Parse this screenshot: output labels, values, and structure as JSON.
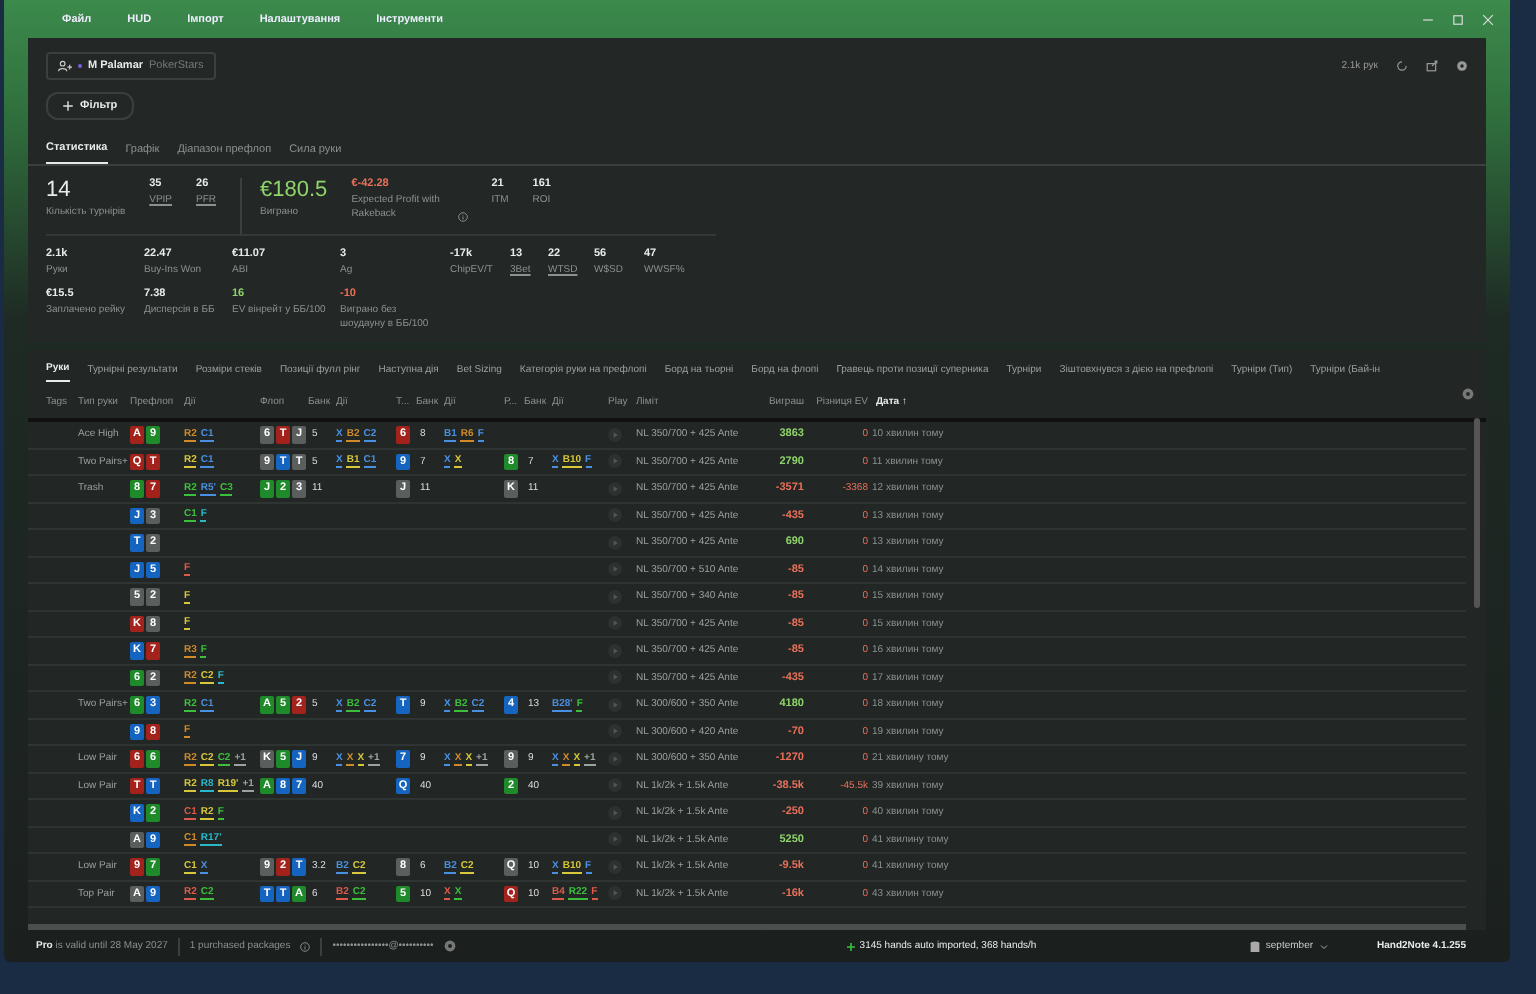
{
  "menu": [
    "Файл",
    "HUD",
    "Імпорт",
    "Налаштування",
    "Інструменти"
  ],
  "player": {
    "name": "M Palamar",
    "site": "PokerStars"
  },
  "hands_count": "2.1k рук",
  "filter_button": "Фільтр",
  "tabs": [
    {
      "label": "Статистика",
      "selected": true
    },
    {
      "label": "Графік",
      "selected": false
    },
    {
      "label": "Діапазон префлоп",
      "selected": false
    },
    {
      "label": "Сила руки",
      "selected": false
    }
  ],
  "summary": [
    {
      "value": "14",
      "label": "Кількість турнірів",
      "kind": "large"
    },
    {
      "value": "35",
      "label": "VPIP",
      "kind": "small",
      "underlined": true
    },
    {
      "value": "26",
      "label": "PFR",
      "kind": "small",
      "underlined": true
    },
    {
      "value": "€180.5",
      "label": "Виграно",
      "kind": "large",
      "color": "#8fd46a",
      "divider_before": true
    },
    {
      "value": "€-42.28",
      "label": "Expected Profit with Rakeback",
      "kind": "small",
      "color": "#e8705a",
      "info": true
    },
    {
      "value": "21",
      "label": "ITM",
      "kind": "small"
    },
    {
      "value": "161",
      "label": "ROI",
      "kind": "small"
    }
  ],
  "stats": [
    {
      "value": "2.1k",
      "label": "Руки"
    },
    {
      "value": "22.47",
      "label": "Buy-Ins Won"
    },
    {
      "value": "€11.07",
      "label": "ABI"
    },
    {
      "value": "3",
      "label": "Ag"
    },
    {
      "value": "-17k",
      "label": "ChipEV/T"
    },
    {
      "value": "13",
      "label": "3Bet",
      "underlined": true
    },
    {
      "value": "22",
      "label": "WTSD",
      "underlined": true
    },
    {
      "value": "56",
      "label": "W$SD"
    },
    {
      "value": "47",
      "label": "WWSF%"
    },
    {
      "value": "€15.5",
      "label": "Заплачено рейку"
    },
    {
      "value": "7.38",
      "label": "Дисперсія в ББ"
    },
    {
      "value": "16",
      "label": "EV вінрейт у ББ/100",
      "color": "#8fd46a"
    },
    {
      "value": "-10",
      "label": "Виграно без шоудауну в ББ/100",
      "color": "#e8705a"
    }
  ],
  "table_tabs": [
    {
      "label": "Руки",
      "selected": true
    },
    {
      "label": "Турнірні результати",
      "selected": false
    },
    {
      "label": "Розміри стеків",
      "selected": false
    },
    {
      "label": "Позиції фулл рінг",
      "selected": false
    },
    {
      "label": "Наступна дія",
      "selected": false
    },
    {
      "label": "Bet Sizing",
      "selected": false
    },
    {
      "label": "Категорія руки на префлопі",
      "selected": false
    },
    {
      "label": "Борд на тьорні",
      "selected": false
    },
    {
      "label": "Борд на флопі",
      "selected": false
    },
    {
      "label": "Гравець проти позиції суперника",
      "selected": false
    },
    {
      "label": "Турніри",
      "selected": false
    },
    {
      "label": "Зіштовхнувся з дією на префлопі",
      "selected": false
    },
    {
      "label": "Турніри (Тип)",
      "selected": false
    },
    {
      "label": "Турніри (Бай-ін",
      "selected": false
    }
  ],
  "columns": [
    {
      "label": "Tags",
      "sorted": false
    },
    {
      "label": "Тип руки",
      "sorted": false
    },
    {
      "label": "Префлоп",
      "sorted": false
    },
    {
      "label": "Дії",
      "sorted": false
    },
    {
      "label": "Флоп",
      "sorted": false
    },
    {
      "label": "Банк",
      "sorted": false
    },
    {
      "label": "Дії",
      "sorted": false
    },
    {
      "label": "Т...",
      "sorted": false
    },
    {
      "label": "Банк",
      "sorted": false
    },
    {
      "label": "Дії",
      "sorted": false
    },
    {
      "label": "Р...",
      "sorted": false
    },
    {
      "label": "Банк",
      "sorted": false
    },
    {
      "label": "Дії",
      "sorted": false
    },
    {
      "label": "Play",
      "sorted": false
    },
    {
      "label": "Ліміт",
      "sorted": false
    },
    {
      "label": "Виграш",
      "sorted": false
    },
    {
      "label": "Різниця EV",
      "sorted": false
    },
    {
      "label": "Дата",
      "sort_arrow": "↑",
      "sorted": true
    }
  ],
  "rows": [
    {
      "type": "Ace High",
      "pre": [
        {
          "rank": "A",
          "color": "#a3231c"
        },
        {
          "rank": "9",
          "color": "#1f8a2a"
        }
      ],
      "pre_act": [
        {
          "text": "R2",
          "color": "#d08a2a"
        },
        {
          "text": "C1",
          "color": "#4a90e2"
        }
      ],
      "flop": [
        {
          "rank": "6",
          "color": "#5a5f5d"
        },
        {
          "rank": "T",
          "color": "#a3231c"
        },
        {
          "rank": "J",
          "color": "#5a5f5d"
        }
      ],
      "flop_pot": "5",
      "flop_act": [
        {
          "text": "X",
          "color": "#4a90e2"
        },
        {
          "text": "B2",
          "color": "#d08a2a"
        },
        {
          "text": "C2",
          "color": "#4a90e2"
        }
      ],
      "turn": [
        {
          "rank": "6",
          "color": "#a3231c"
        }
      ],
      "turn_pot": "8",
      "turn_act": [
        {
          "text": "B1",
          "color": "#4a90e2"
        },
        {
          "text": "R6",
          "color": "#d08a2a"
        },
        {
          "text": "F",
          "color": "#4a90e2"
        }
      ],
      "limit": "NL 350/700 + 425 Ante",
      "win": {
        "text": "3863",
        "color": "#8fd46a"
      },
      "ev": "0",
      "date": "10 хвилин тому"
    },
    {
      "type": "Two Pairs+",
      "pre": [
        {
          "rank": "Q",
          "color": "#a3231c"
        },
        {
          "rank": "T",
          "color": "#a3231c"
        }
      ],
      "pre_act": [
        {
          "text": "R2",
          "color": "#d6c83a"
        },
        {
          "text": "C1",
          "color": "#4a90e2"
        }
      ],
      "flop": [
        {
          "rank": "9",
          "color": "#5a5f5d"
        },
        {
          "rank": "T",
          "color": "#1565c0"
        },
        {
          "rank": "T",
          "color": "#5a5f5d"
        }
      ],
      "flop_pot": "5",
      "flop_act": [
        {
          "text": "X",
          "color": "#4a90e2"
        },
        {
          "text": "B1",
          "color": "#d6c83a"
        },
        {
          "text": "C1",
          "color": "#4a90e2"
        }
      ],
      "turn": [
        {
          "rank": "9",
          "color": "#1565c0"
        }
      ],
      "turn_pot": "7",
      "turn_act": [
        {
          "text": "X",
          "color": "#4a90e2"
        },
        {
          "text": "X",
          "color": "#d6c83a"
        }
      ],
      "river": [
        {
          "rank": "8",
          "color": "#1f8a2a"
        }
      ],
      "river_pot": "7",
      "river_act": [
        {
          "text": "X",
          "color": "#4a90e2"
        },
        {
          "text": "B10",
          "color": "#d6c83a"
        },
        {
          "text": "F",
          "color": "#4a90e2"
        }
      ],
      "limit": "NL 350/700 + 425 Ante",
      "win": {
        "text": "2790",
        "color": "#8fd46a"
      },
      "ev": "0",
      "date": "11 хвилин тому"
    },
    {
      "type": "Trash",
      "pre": [
        {
          "rank": "8",
          "color": "#1f8a2a"
        },
        {
          "rank": "7",
          "color": "#a3231c"
        }
      ],
      "pre_act": [
        {
          "text": "R2",
          "color": "#3cc03c"
        },
        {
          "text": "R5'",
          "color": "#4a90e2"
        },
        {
          "text": "C3",
          "color": "#3cc03c"
        }
      ],
      "flop": [
        {
          "rank": "J",
          "color": "#1f8a2a"
        },
        {
          "rank": "2",
          "color": "#1f8a2a"
        },
        {
          "rank": "3",
          "color": "#5a5f5d"
        }
      ],
      "flop_pot": "11",
      "turn": [
        {
          "rank": "J",
          "color": "#5a5f5d"
        }
      ],
      "turn_pot": "11",
      "river": [
        {
          "rank": "K",
          "color": "#5a5f5d"
        }
      ],
      "river_pot": "11",
      "limit": "NL 350/700 + 425 Ante",
      "win": {
        "text": "-3571",
        "color": "#e8705a"
      },
      "ev": "-3368",
      "date": "12 хвилин тому"
    },
    {
      "pre": [
        {
          "rank": "J",
          "color": "#1565c0"
        },
        {
          "rank": "3",
          "color": "#5a5f5d"
        }
      ],
      "pre_act": [
        {
          "text": "C1",
          "color": "#3cc03c"
        },
        {
          "text": "F",
          "color": "#2ab8c8"
        }
      ],
      "limit": "NL 350/700 + 425 Ante",
      "win": {
        "text": "-435",
        "color": "#e8705a"
      },
      "ev": "0",
      "date": "13 хвилин тому"
    },
    {
      "pre": [
        {
          "rank": "T",
          "color": "#1565c0"
        },
        {
          "rank": "2",
          "color": "#5a5f5d"
        }
      ],
      "limit": "NL 350/700 + 425 Ante",
      "win": {
        "text": "690",
        "color": "#8fd46a"
      },
      "ev": "0",
      "date": "13 хвилин тому"
    },
    {
      "pre": [
        {
          "rank": "J",
          "color": "#1565c0"
        },
        {
          "rank": "5",
          "color": "#1565c0"
        }
      ],
      "pre_act": [
        {
          "text": "F",
          "color": "#e05a4a"
        }
      ],
      "limit": "NL 350/700 + 510 Ante",
      "win": {
        "text": "-85",
        "color": "#e8705a"
      },
      "ev": "0",
      "date": "14 хвилин тому"
    },
    {
      "pre": [
        {
          "rank": "5",
          "color": "#5a5f5d"
        },
        {
          "rank": "2",
          "color": "#5a5f5d"
        }
      ],
      "pre_act": [
        {
          "text": "F",
          "color": "#d6c83a"
        }
      ],
      "limit": "NL 350/700 + 340 Ante",
      "win": {
        "text": "-85",
        "color": "#e8705a"
      },
      "ev": "0",
      "date": "15 хвилин тому"
    },
    {
      "pre": [
        {
          "rank": "K",
          "color": "#a3231c"
        },
        {
          "rank": "8",
          "color": "#5a5f5d"
        }
      ],
      "pre_act": [
        {
          "text": "F",
          "color": "#d6c83a"
        }
      ],
      "limit": "NL 350/700 + 425 Ante",
      "win": {
        "text": "-85",
        "color": "#e8705a"
      },
      "ev": "0",
      "date": "15 хвилин тому"
    },
    {
      "pre": [
        {
          "rank": "K",
          "color": "#1565c0"
        },
        {
          "rank": "7",
          "color": "#a3231c"
        }
      ],
      "pre_act": [
        {
          "text": "R3",
          "color": "#d08a2a"
        },
        {
          "text": "F",
          "color": "#3cc03c"
        }
      ],
      "limit": "NL 350/700 + 425 Ante",
      "win": {
        "text": "-85",
        "color": "#e8705a"
      },
      "ev": "0",
      "date": "16 хвилин тому"
    },
    {
      "pre": [
        {
          "rank": "6",
          "color": "#1f8a2a"
        },
        {
          "rank": "2",
          "color": "#5a5f5d"
        }
      ],
      "pre_act": [
        {
          "text": "R2",
          "color": "#d08a2a"
        },
        {
          "text": "C2",
          "color": "#d6c83a"
        },
        {
          "text": "F",
          "color": "#2ab8c8"
        }
      ],
      "limit": "NL 350/700 + 425 Ante",
      "win": {
        "text": "-435",
        "color": "#e8705a"
      },
      "ev": "0",
      "date": "17 хвилин тому"
    },
    {
      "type": "Two Pairs+",
      "pre": [
        {
          "rank": "6",
          "color": "#1f8a2a"
        },
        {
          "rank": "3",
          "color": "#1565c0"
        }
      ],
      "pre_act": [
        {
          "text": "R2",
          "color": "#3cc03c"
        },
        {
          "text": "C1",
          "color": "#4a90e2"
        }
      ],
      "flop": [
        {
          "rank": "A",
          "color": "#1f8a2a"
        },
        {
          "rank": "5",
          "color": "#1f8a2a"
        },
        {
          "rank": "2",
          "color": "#a3231c"
        }
      ],
      "flop_pot": "5",
      "flop_act": [
        {
          "text": "X",
          "color": "#4a90e2"
        },
        {
          "text": "B2",
          "color": "#3cc03c"
        },
        {
          "text": "C2",
          "color": "#4a90e2"
        }
      ],
      "turn": [
        {
          "rank": "T",
          "color": "#1565c0"
        }
      ],
      "turn_pot": "9",
      "turn_act": [
        {
          "text": "X",
          "color": "#4a90e2"
        },
        {
          "text": "B2",
          "color": "#3cc03c"
        },
        {
          "text": "C2",
          "color": "#4a90e2"
        }
      ],
      "river": [
        {
          "rank": "4",
          "color": "#1565c0"
        }
      ],
      "river_pot": "13",
      "river_act": [
        {
          "text": "B28'",
          "color": "#4a90e2"
        },
        {
          "text": "F",
          "color": "#3cc03c"
        }
      ],
      "limit": "NL 300/600 + 350 Ante",
      "win": {
        "text": "4180",
        "color": "#8fd46a"
      },
      "ev": "0",
      "date": "18 хвилин тому"
    },
    {
      "pre": [
        {
          "rank": "9",
          "color": "#1565c0"
        },
        {
          "rank": "8",
          "color": "#a3231c"
        }
      ],
      "pre_act": [
        {
          "text": "F",
          "color": "#d08a2a"
        }
      ],
      "limit": "NL 300/600 + 420 Ante",
      "win": {
        "text": "-70",
        "color": "#e8705a"
      },
      "ev": "0",
      "date": "19 хвилин тому"
    },
    {
      "type": "Low Pair",
      "pre": [
        {
          "rank": "6",
          "color": "#a3231c"
        },
        {
          "rank": "6",
          "color": "#1f8a2a"
        }
      ],
      "pre_act": [
        {
          "text": "R2",
          "color": "#d08a2a"
        },
        {
          "text": "C2",
          "color": "#d6c83a"
        },
        {
          "text": "C2",
          "color": "#3cc03c"
        },
        {
          "text": "+1",
          "color": "#9aa3a0"
        }
      ],
      "flop": [
        {
          "rank": "K",
          "color": "#5a5f5d"
        },
        {
          "rank": "5",
          "color": "#1f8a2a"
        },
        {
          "rank": "J",
          "color": "#1565c0"
        }
      ],
      "flop_pot": "9",
      "flop_act": [
        {
          "text": "X",
          "color": "#4a90e2"
        },
        {
          "text": "X",
          "color": "#d08a2a"
        },
        {
          "text": "X",
          "color": "#d6c83a"
        },
        {
          "text": "+1",
          "color": "#9aa3a0"
        }
      ],
      "turn": [
        {
          "rank": "7",
          "color": "#1565c0"
        }
      ],
      "turn_pot": "9",
      "turn_act": [
        {
          "text": "X",
          "color": "#4a90e2"
        },
        {
          "text": "X",
          "color": "#d08a2a"
        },
        {
          "text": "X",
          "color": "#d6c83a"
        },
        {
          "text": "+1",
          "color": "#9aa3a0"
        }
      ],
      "river": [
        {
          "rank": "9",
          "color": "#5a5f5d"
        }
      ],
      "river_pot": "9",
      "river_act": [
        {
          "text": "X",
          "color": "#4a90e2"
        },
        {
          "text": "X",
          "color": "#d08a2a"
        },
        {
          "text": "X",
          "color": "#d6c83a"
        },
        {
          "text": "+1",
          "color": "#9aa3a0"
        }
      ],
      "limit": "NL 300/600 + 350 Ante",
      "win": {
        "text": "-1270",
        "color": "#e8705a"
      },
      "ev": "0",
      "date": "21 хвилину тому"
    },
    {
      "type": "Low Pair",
      "pre": [
        {
          "rank": "T",
          "color": "#a3231c"
        },
        {
          "rank": "T",
          "color": "#1565c0"
        }
      ],
      "pre_act": [
        {
          "text": "R2",
          "color": "#d6c83a"
        },
        {
          "text": "R8",
          "color": "#2ab8c8"
        },
        {
          "text": "R19'",
          "color": "#d6c83a"
        },
        {
          "text": "+1",
          "color": "#9aa3a0"
        }
      ],
      "flop": [
        {
          "rank": "A",
          "color": "#1f8a2a"
        },
        {
          "rank": "8",
          "color": "#1565c0"
        },
        {
          "rank": "7",
          "color": "#1565c0"
        }
      ],
      "flop_pot": "40",
      "turn": [
        {
          "rank": "Q",
          "color": "#1565c0"
        }
      ],
      "turn_pot": "40",
      "river": [
        {
          "rank": "2",
          "color": "#1f8a2a"
        }
      ],
      "river_pot": "40",
      "limit": "NL 1k/2k + 1.5k Ante",
      "win": {
        "text": "-38.5k",
        "color": "#e8705a"
      },
      "ev": "-45.5k",
      "date": "39 хвилин тому"
    },
    {
      "pre": [
        {
          "rank": "K",
          "color": "#1565c0"
        },
        {
          "rank": "2",
          "color": "#1f8a2a"
        }
      ],
      "pre_act": [
        {
          "text": "C1",
          "color": "#e05a4a"
        },
        {
          "text": "R2",
          "color": "#d6c83a"
        },
        {
          "text": "F",
          "color": "#3cc03c"
        }
      ],
      "limit": "NL 1k/2k + 1.5k Ante",
      "win": {
        "text": "-250",
        "color": "#e8705a"
      },
      "ev": "0",
      "date": "40 хвилин тому"
    },
    {
      "pre": [
        {
          "rank": "A",
          "color": "#5a5f5d"
        },
        {
          "rank": "9",
          "color": "#1565c0"
        }
      ],
      "pre_act": [
        {
          "text": "C1",
          "color": "#d08a2a"
        },
        {
          "text": "R17'",
          "color": "#2ab8c8"
        }
      ],
      "limit": "NL 1k/2k + 1.5k Ante",
      "win": {
        "text": "5250",
        "color": "#8fd46a"
      },
      "ev": "0",
      "date": "41 хвилину тому"
    },
    {
      "type": "Low Pair",
      "pre": [
        {
          "rank": "9",
          "color": "#a3231c"
        },
        {
          "rank": "7",
          "color": "#1f8a2a"
        }
      ],
      "pre_act": [
        {
          "text": "C1",
          "color": "#d6c83a"
        },
        {
          "text": "X",
          "color": "#4a90e2"
        }
      ],
      "flop": [
        {
          "rank": "9",
          "color": "#5a5f5d"
        },
        {
          "rank": "2",
          "color": "#a3231c"
        },
        {
          "rank": "T",
          "color": "#1565c0"
        }
      ],
      "flop_pot": "3.2",
      "flop_act": [
        {
          "text": "B2",
          "color": "#4a90e2"
        },
        {
          "text": "C2",
          "color": "#d6c83a"
        }
      ],
      "turn": [
        {
          "rank": "8",
          "color": "#5a5f5d"
        }
      ],
      "turn_pot": "6",
      "turn_act": [
        {
          "text": "B2",
          "color": "#4a90e2"
        },
        {
          "text": "C2",
          "color": "#d6c83a"
        }
      ],
      "river": [
        {
          "rank": "Q",
          "color": "#5a5f5d"
        }
      ],
      "river_pot": "10",
      "river_act": [
        {
          "text": "X",
          "color": "#4a90e2"
        },
        {
          "text": "B10",
          "color": "#d6c83a"
        },
        {
          "text": "F",
          "color": "#4a90e2"
        }
      ],
      "limit": "NL 1k/2k + 1.5k Ante",
      "win": {
        "text": "-9.5k",
        "color": "#e8705a"
      },
      "ev": "0",
      "date": "41 хвилину тому"
    },
    {
      "type": "Top Pair",
      "pre": [
        {
          "rank": "A",
          "color": "#5a5f5d"
        },
        {
          "rank": "9",
          "color": "#1565c0"
        }
      ],
      "pre_act": [
        {
          "text": "R2",
          "color": "#e05a4a"
        },
        {
          "text": "C2",
          "color": "#3cc03c"
        }
      ],
      "flop": [
        {
          "rank": "T",
          "color": "#1565c0"
        },
        {
          "rank": "T",
          "color": "#1565c0"
        },
        {
          "rank": "A",
          "color": "#1f8a2a"
        }
      ],
      "flop_pot": "6",
      "flop_act": [
        {
          "text": "B2",
          "color": "#e05a4a"
        },
        {
          "text": "C2",
          "color": "#3cc03c"
        }
      ],
      "turn": [
        {
          "rank": "5",
          "color": "#1f8a2a"
        }
      ],
      "turn_pot": "10",
      "turn_act": [
        {
          "text": "X",
          "color": "#e05a4a"
        },
        {
          "text": "X",
          "color": "#3cc03c"
        }
      ],
      "river": [
        {
          "rank": "Q",
          "color": "#a3231c"
        }
      ],
      "river_pot": "10",
      "river_act": [
        {
          "text": "B4",
          "color": "#e05a4a"
        },
        {
          "text": "R22",
          "color": "#3cc03c"
        },
        {
          "text": "F",
          "color": "#e05a4a"
        }
      ],
      "limit": "NL 1k/2k + 1.5k Ante",
      "win": {
        "text": "-16k",
        "color": "#e8705a"
      },
      "ev": "0",
      "date": "43 хвилин тому"
    }
  ],
  "status": {
    "license": "**Pro** is valid until 28 May 2027",
    "packages": "1 purchased packages",
    "account": "••••••••••••••••@••••••••••",
    "import": "3145 hands auto imported, 368 hands/h",
    "database": "september",
    "version": "Hand2Note 4.1.255"
  }
}
